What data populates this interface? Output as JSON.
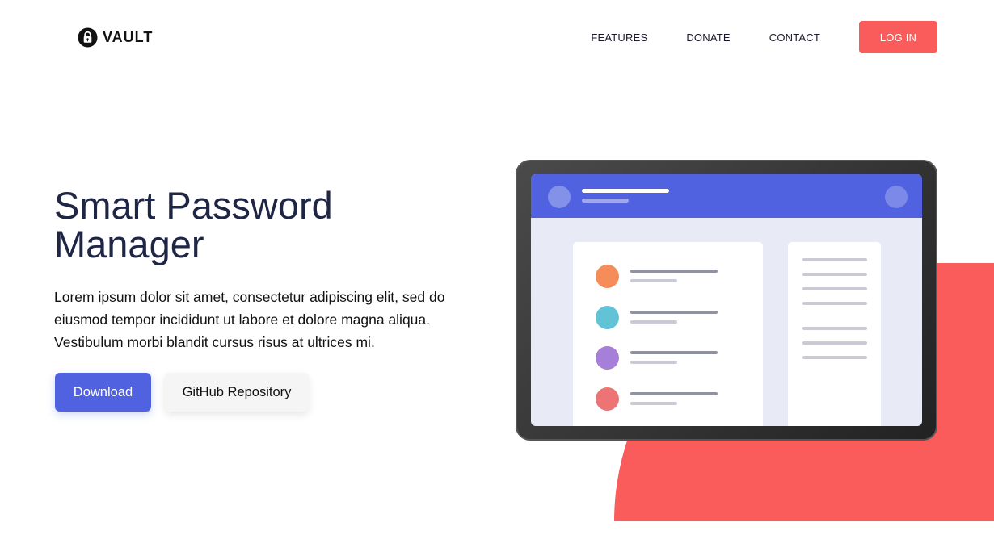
{
  "brand": {
    "name": "VAULT",
    "icon": "lock-icon"
  },
  "nav": {
    "links": [
      "FEATURES",
      "DONATE",
      "CONTACT"
    ],
    "login_label": "LOG IN"
  },
  "hero": {
    "title": "Smart Password Manager",
    "description": "Lorem ipsum dolor sit amet, consectetur adipiscing elit, sed do eiusmod tempor incididunt ut labore et dolore magna aliqua. Vestibulum morbi blandit cursus risus at ultrices mi.",
    "primary_button": "Download",
    "secondary_button": "GitHub Repository"
  },
  "illustration": {
    "list_item_colors": [
      "#f58c5a",
      "#63c3d6",
      "#a67fd8",
      "#ec7474"
    ]
  },
  "colors": {
    "accent": "#5062e0",
    "brand_red": "#fa5b5b",
    "title_text": "#1f2544"
  }
}
